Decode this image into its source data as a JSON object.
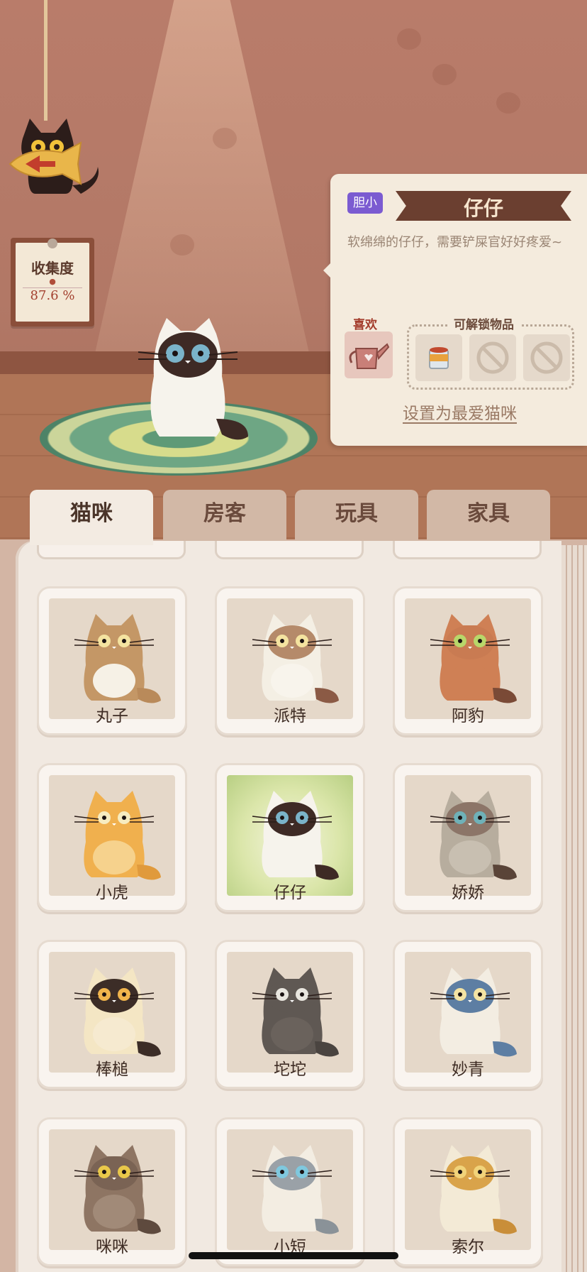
{
  "collection": {
    "title": "收集度",
    "value": "87.6 %"
  },
  "selected_cat": {
    "trait": "胆小",
    "name": "仔仔",
    "description": "软绵绵的仔仔，需要铲屎官好好疼爱~",
    "likes_label": "喜欢",
    "likes_item_icon": "watering-can-icon",
    "unlockables_label": "可解锁物品",
    "unlockables": [
      {
        "icon": "cat-food-can-icon",
        "locked": false
      },
      {
        "icon": "locked-slot-icon",
        "locked": true
      },
      {
        "icon": "locked-slot-icon",
        "locked": true
      }
    ],
    "set_favorite_label": "设置为最爱猫咪"
  },
  "tabs": [
    {
      "label": "猫咪",
      "active": true
    },
    {
      "label": "房客",
      "active": false
    },
    {
      "label": "玩具",
      "active": false
    },
    {
      "label": "家具",
      "active": false
    }
  ],
  "cats": [
    {
      "name": "丸子",
      "body": "#c49766",
      "belly": "#f6f1e6",
      "face": "#c49766",
      "eyes": "#f4e3a0",
      "tail": "#b98a5a",
      "selected": false
    },
    {
      "name": "派特",
      "body": "#f4efe4",
      "belly": "#f8f4ec",
      "face": "#b58a6a",
      "eyes": "#f4e3a0",
      "tail": "#8b5a45",
      "selected": false
    },
    {
      "name": "阿豹",
      "body": "#cf8055",
      "belly": "#cf8055",
      "face": "#c97b52",
      "eyes": "#b8d76a",
      "tail": "#7a4a36",
      "selected": false
    },
    {
      "name": "小虎",
      "body": "#f0b04e",
      "belly": "#f6d28d",
      "face": "#f0b04e",
      "eyes": "#f7ecc0",
      "tail": "#e09a3c",
      "selected": false
    },
    {
      "name": "仔仔",
      "body": "#f6f3ec",
      "belly": "#f6f3ec",
      "face": "#3e2a25",
      "eyes": "#7ab3c9",
      "tail": "#3e2a25",
      "selected": true
    },
    {
      "name": "娇娇",
      "body": "#b7ad9e",
      "belly": "#c8bfb1",
      "face": "#8c7568",
      "eyes": "#6fb1b8",
      "tail": "#5a4438",
      "selected": false
    },
    {
      "name": "棒槌",
      "body": "#f4e6c4",
      "belly": "#f6ead0",
      "face": "#3c2d27",
      "eyes": "#f0b44c",
      "tail": "#3c2d27",
      "selected": false
    },
    {
      "name": "坨坨",
      "body": "#5f5853",
      "belly": "#6a625c",
      "face": "#5f5853",
      "eyes": "#e9e6df",
      "tail": "#4a4440",
      "selected": false
    },
    {
      "name": "妙青",
      "body": "#f3ede2",
      "belly": "#f3ede2",
      "face": "#5d7ea3",
      "eyes": "#f3e3a3",
      "tail": "#5d7ea3",
      "selected": false
    },
    {
      "name": "咪咪",
      "body": "#8e7563",
      "belly": "#a18a78",
      "face": "#7a6354",
      "eyes": "#e9c84a",
      "tail": "#5e4a3e",
      "selected": false
    },
    {
      "name": "小短",
      "body": "#f3ede2",
      "belly": "#f3ede2",
      "face": "#9aa1a7",
      "eyes": "#7fc8de",
      "tail": "#8a9298",
      "selected": false
    },
    {
      "name": "索尔",
      "body": "#f3ead6",
      "belly": "#f3ead6",
      "face": "#d9a34a",
      "eyes": "#f1d37a",
      "tail": "#c98e39",
      "selected": false
    }
  ]
}
